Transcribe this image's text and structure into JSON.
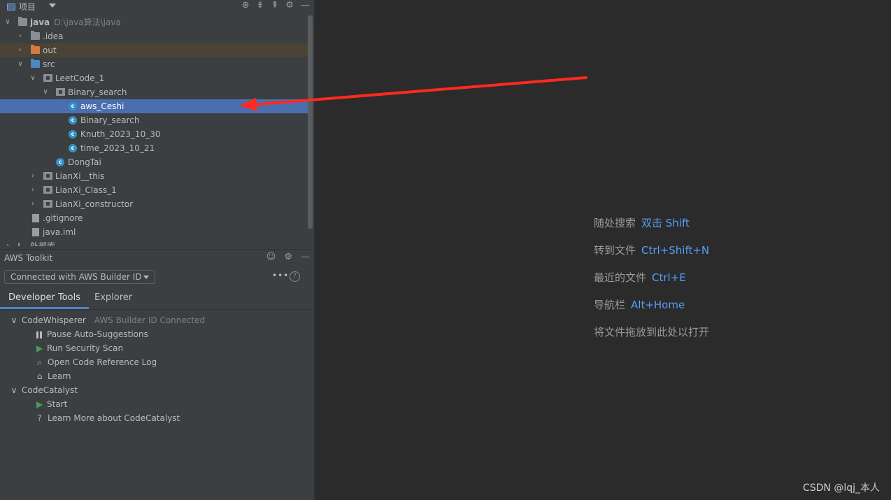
{
  "project_panel": {
    "title": "项目",
    "icons": [
      "target-icon",
      "expand-all-icon",
      "collapse-all-icon",
      "gear-icon",
      "minimize-icon"
    ]
  },
  "tree": {
    "root_label": "java",
    "root_path": "D:\\java算法\\java",
    "idea": ".idea",
    "out": "out",
    "src": "src",
    "leetcode": "LeetCode_1",
    "binary_pkg": "Binary_search",
    "aws_ceshi": "aws_Ceshi",
    "binary_cls": "Binary_search",
    "knuth": "Knuth_2023_10_30",
    "time": "time_2023_10_21",
    "dongtai": "DongTai",
    "lianxi_this": "LianXi__this",
    "lianxi_class": "LianXi_Class_1",
    "lianxi_constructor": "LianXi_constructor",
    "gitignore": ".gitignore",
    "java_iml": "java.iml",
    "external": "外部库"
  },
  "aws": {
    "title": "AWS Toolkit",
    "connection": "Connected with AWS Builder ID",
    "more": "•••",
    "help": "?",
    "tabs": [
      "Developer Tools",
      "Explorer"
    ],
    "codewhisperer": "CodeWhisperer",
    "cw_status": "AWS Builder ID Connected",
    "pause": "Pause Auto-Suggestions",
    "scan": "Run Security Scan",
    "reflog": "Open Code Reference Log",
    "learn": "Learn",
    "codecatalyst": "CodeCatalyst",
    "start": "Start",
    "learn_more": "Learn More about CodeCatalyst"
  },
  "hints": [
    {
      "text": "随处搜索",
      "key": "双击 Shift"
    },
    {
      "text": "转到文件",
      "key": "Ctrl+Shift+N"
    },
    {
      "text": "最近的文件",
      "key": "Ctrl+E"
    },
    {
      "text": "导航栏",
      "key": "Alt+Home"
    },
    {
      "text": "将文件拖放到此处以打开",
      "key": ""
    }
  ],
  "watermark": "CSDN @lqj_本人",
  "colors": {
    "selection": "#4b6eaf",
    "accent": "#589df6",
    "arrow": "#ff2a1f",
    "run": "#499c54"
  }
}
